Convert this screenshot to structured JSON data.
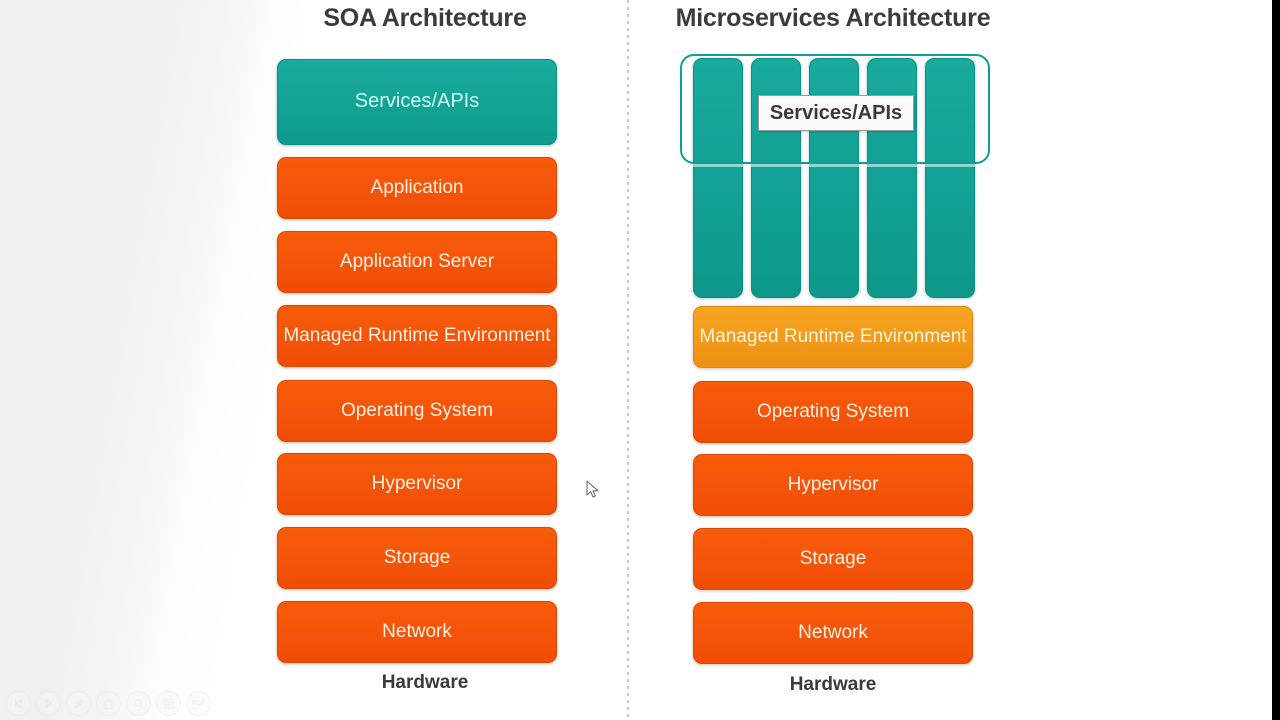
{
  "slide": {
    "left_column": {
      "title": "SOA Architecture",
      "hardware_caption": "Hardware",
      "layers": [
        {
          "label": "Services/APIs",
          "kind": "teal"
        },
        {
          "label": "Application",
          "kind": "orange"
        },
        {
          "label": "Application Server",
          "kind": "orange"
        },
        {
          "label": "Managed Runtime Environment",
          "kind": "orange"
        },
        {
          "label": "Operating System",
          "kind": "orange"
        },
        {
          "label": "Hypervisor",
          "kind": "orange"
        },
        {
          "label": "Storage",
          "kind": "orange"
        },
        {
          "label": "Network",
          "kind": "orange"
        }
      ]
    },
    "right_column": {
      "title": "Microservices Architecture",
      "hardware_caption": "Hardware",
      "services_label": "Services/APIs",
      "microservice_bar_count": 5,
      "layers": [
        {
          "label": "Managed Runtime Environment",
          "kind": "amber"
        },
        {
          "label": "Operating System",
          "kind": "orange"
        },
        {
          "label": "Hypervisor",
          "kind": "orange"
        },
        {
          "label": "Storage",
          "kind": "orange"
        },
        {
          "label": "Network",
          "kind": "orange"
        }
      ]
    },
    "colors": {
      "teal": "#12a294",
      "orange": "#f4540a",
      "amber": "#f2991a",
      "title_text": "#3b3b3b",
      "divider": "#c9c9c9",
      "right_bar": "#000000"
    }
  },
  "toolbar": {
    "items": [
      {
        "name": "previous-button",
        "glyph": "back"
      },
      {
        "name": "play-button",
        "glyph": "play"
      },
      {
        "name": "pen-button",
        "glyph": "pen"
      },
      {
        "name": "delete-button",
        "glyph": "trash"
      },
      {
        "name": "zoom-button",
        "glyph": "search"
      },
      {
        "name": "notes-button",
        "glyph": "note"
      },
      {
        "name": "pdf-button",
        "glyph": "PDF"
      }
    ],
    "pdf_text": "PDF"
  }
}
